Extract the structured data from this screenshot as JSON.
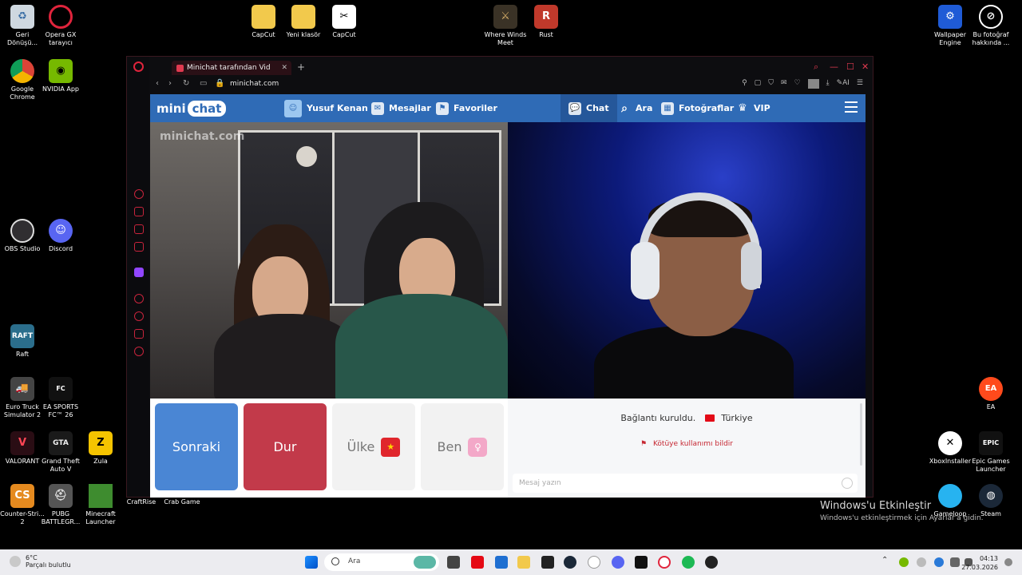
{
  "desktop": {
    "left_icons": [
      {
        "label": "Geri Dönüşü...",
        "icon": "recycle-bin-icon"
      },
      {
        "label": "Opera GX tarayıcı",
        "icon": "opera-gx-icon"
      },
      {
        "label": "Google Chrome",
        "icon": "chrome-icon"
      },
      {
        "label": "NVIDIA App",
        "icon": "nvidia-icon"
      },
      {
        "label": "OBS Studio",
        "icon": "obs-icon"
      },
      {
        "label": "Discord",
        "icon": "discord-icon"
      },
      {
        "label": "Raft",
        "icon": "raft-icon"
      },
      {
        "label": "Euro Truck Simulator 2",
        "icon": "truck-icon"
      },
      {
        "label": "EA SPORTS FC™ 26",
        "icon": "fc26-icon"
      },
      {
        "label": "VALORANT",
        "icon": "valorant-icon"
      },
      {
        "label": "Grand Theft Auto V",
        "icon": "gta-icon"
      },
      {
        "label": "Zula",
        "icon": "zula-icon"
      },
      {
        "label": "Counter-Stri... 2",
        "icon": "counter-strike-icon"
      },
      {
        "label": "PUBG BATTLEGR...",
        "icon": "pubg-icon"
      },
      {
        "label": "Minecraft Launcher",
        "icon": "minecraft-icon"
      },
      {
        "label": "CraftRise",
        "icon": "craftrise-icon"
      },
      {
        "label": "Crab Game",
        "icon": "crab-game-icon"
      }
    ],
    "top_icons": [
      {
        "label": "CapCut",
        "icon": "folder-icon"
      },
      {
        "label": "Yeni klasör",
        "icon": "folder-icon"
      },
      {
        "label": "CapCut",
        "icon": "capcut-icon"
      },
      {
        "label": "Where Winds Meet",
        "icon": "where-winds-meet-icon"
      },
      {
        "label": "Rust",
        "icon": "rust-icon"
      }
    ],
    "right_icons": [
      {
        "label": "Wallpaper Engine",
        "icon": "wallpaper-engine-icon"
      },
      {
        "label": "Bu fotoğraf hakkında ...",
        "icon": "photo-info-icon"
      },
      {
        "label": "EA",
        "icon": "ea-icon"
      },
      {
        "label": "XboxInstaller",
        "icon": "xbox-icon"
      },
      {
        "label": "Epic Games Launcher",
        "icon": "epic-games-icon"
      },
      {
        "label": "Gameloop",
        "icon": "gameloop-icon"
      },
      {
        "label": "Steam",
        "icon": "steam-icon"
      }
    ],
    "activation_title": "Windows'u Etkinleştir",
    "activation_subtitle": "Windows'u etkinleştirmek için Ayarlar'a gidin."
  },
  "browser": {
    "tab_title": "Minichat tarafından Vid",
    "url": "minichat.com"
  },
  "site": {
    "logo_mini": "mini",
    "logo_chat": "chat",
    "user_name": "Yusuf Kenan",
    "nav": {
      "messages": "Mesajlar",
      "favorites": "Favoriler",
      "chat": "Chat",
      "search": "Ara",
      "photos": "Fotoğraflar",
      "vip": "VIP"
    },
    "video_watermark": "minichat.com",
    "controls": {
      "next": "Sonraki",
      "stop": "Dur",
      "country": "Ülke",
      "me": "Ben"
    },
    "chat": {
      "status": "Bağlantı kuruldu.",
      "country": "Türkiye",
      "report": "Kötüye kullanımı bildir",
      "message_placeholder": "Mesaj yazın"
    }
  },
  "taskbar": {
    "weather_temp": "6°C",
    "weather_desc": "Parçalı bulutlu",
    "search_placeholder": "Ara",
    "time": "04:13",
    "date": "27.03.2026"
  },
  "colors": {
    "site_blue": "#2f6bb6",
    "next_button": "#4a86d4",
    "stop_button": "#c23a4a",
    "opera_red": "#e03a50"
  }
}
